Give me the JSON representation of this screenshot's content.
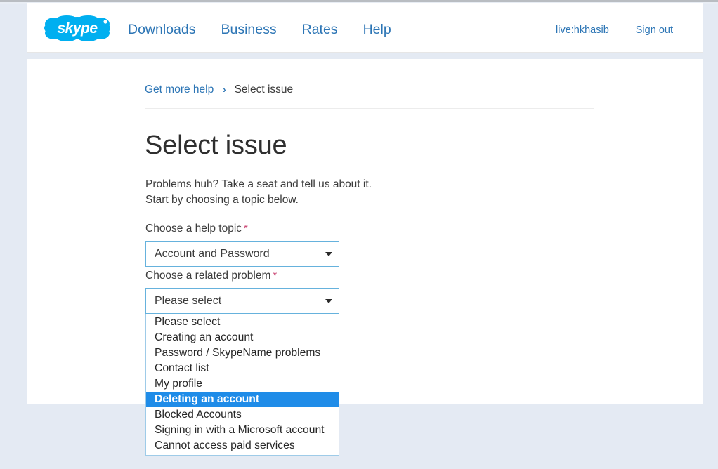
{
  "header": {
    "logo_text": "skype",
    "logo_icon": "skype-cloud-logo",
    "nav": [
      {
        "label": "Downloads"
      },
      {
        "label": "Business"
      },
      {
        "label": "Rates"
      },
      {
        "label": "Help"
      }
    ],
    "account": {
      "username": "live:hkhasib",
      "sign_out_label": "Sign out"
    }
  },
  "breadcrumb": {
    "parent_label": "Get more help",
    "separator": "›",
    "current_label": "Select issue"
  },
  "main": {
    "title": "Select issue",
    "intro_line1": "Problems huh? Take a seat and tell us about it.",
    "intro_line2": "Start by choosing a topic below.",
    "required_marker": "*",
    "help_topic": {
      "label": "Choose a help topic",
      "selected": "Account and Password",
      "arrow_icon": "chevron-down-icon"
    },
    "related_problem": {
      "label": "Choose a related problem",
      "selected": "Please select",
      "arrow_icon": "chevron-down-icon",
      "expanded": true,
      "options": [
        "Please select",
        "Creating an account",
        "Password / SkypeName problems",
        "Contact list",
        "My profile",
        "Deleting an account",
        "Blocked Accounts",
        "Signing in with a Microsoft account",
        "Cannot access paid services"
      ],
      "highlighted_option": "Deleting an account",
      "highlighted_index": 5
    }
  },
  "colors": {
    "brand_blue": "#00AFF0",
    "link_blue": "#2C75B5",
    "select_border": "#66B2DD",
    "highlight_blue": "#1F8CE8",
    "required_pink": "#C83E6E",
    "page_bg": "#E4EAF3"
  }
}
